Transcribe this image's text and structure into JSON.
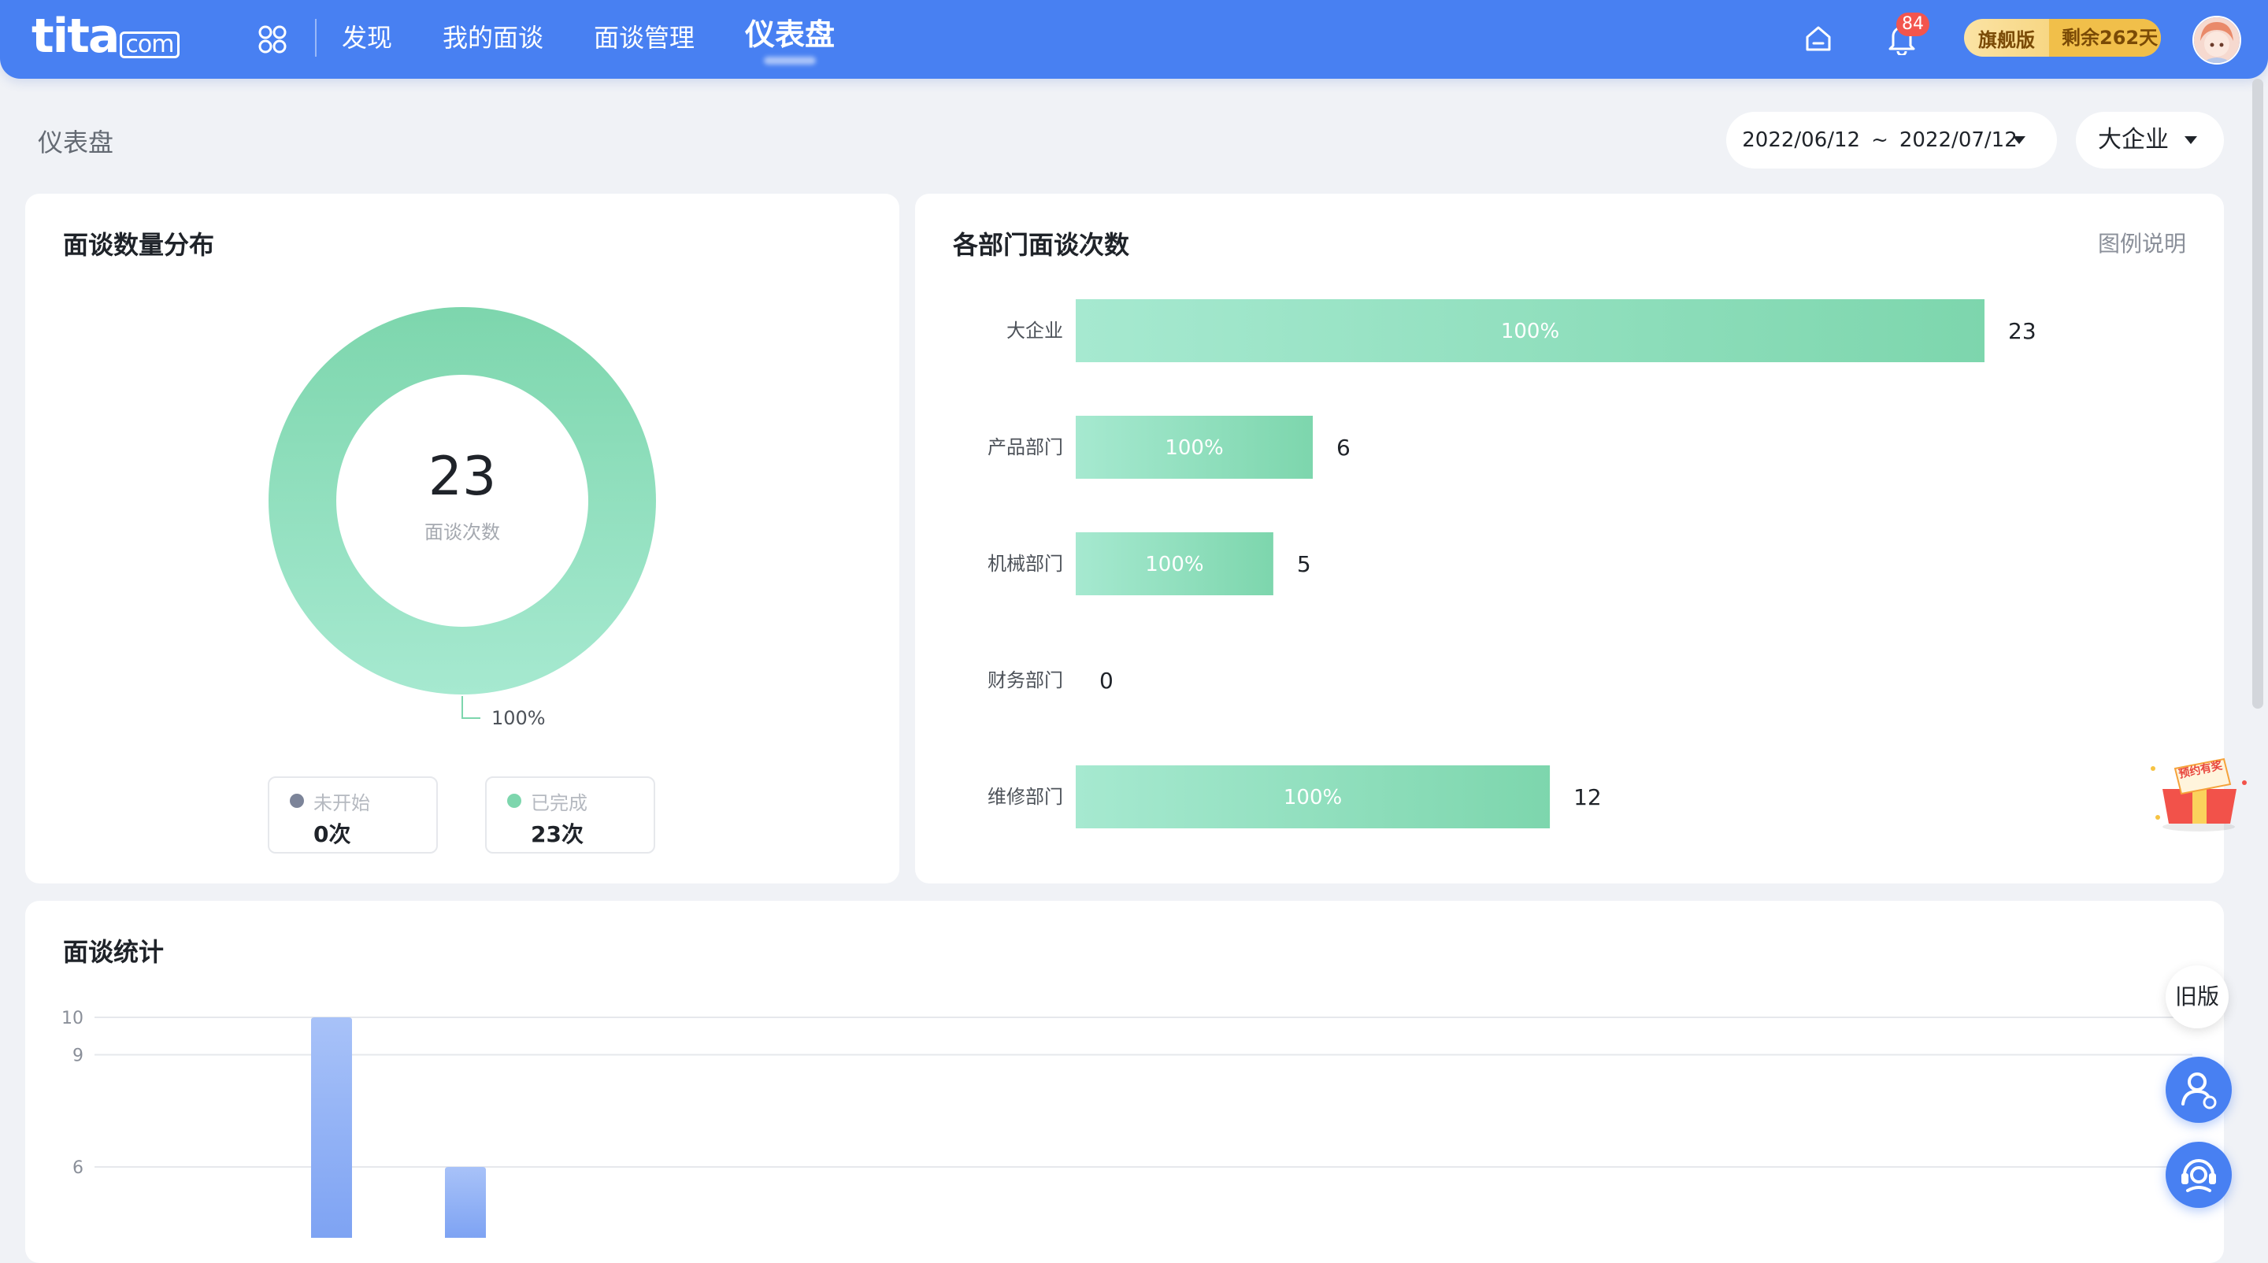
{
  "nav": {
    "logo_main": "tita",
    "logo_suffix": "com",
    "items": [
      "发现",
      "我的面谈",
      "面谈管理",
      "仪表盘"
    ],
    "active_index": 3,
    "notifications_count": "84",
    "plan_name": "旗舰版",
    "plan_remaining": "剩余262天"
  },
  "page": {
    "title": "仪表盘",
    "date_start": "2022/06/12",
    "date_separator": "~",
    "date_end": "2022/07/12",
    "dept_selected": "大企业"
  },
  "donut_card": {
    "title": "面谈数量分布",
    "center_value": "23",
    "center_label": "面谈次数",
    "slice_label": "100%",
    "legend": [
      {
        "label": "未开始",
        "value": "0次",
        "color": "#7c8499"
      },
      {
        "label": "已完成",
        "value": "23次",
        "color": "#7dd6ad"
      }
    ]
  },
  "bar_card": {
    "title": "各部门面谈次数",
    "legend_link": "图例说明"
  },
  "stats_card": {
    "title": "面谈统计"
  },
  "floating": {
    "old_version": "旧版",
    "gift_text": "预约有奖"
  },
  "colors": {
    "brand": "#4880f2",
    "green_start": "#a6e9d0",
    "green_end": "#7dd6ad",
    "blue_bar": "#8fb0f6"
  },
  "chart_data": [
    {
      "type": "pie",
      "title": "面谈数量分布",
      "categories": [
        "未开始",
        "已完成"
      ],
      "values": [
        0,
        23
      ],
      "total": 23
    },
    {
      "type": "bar",
      "orientation": "horizontal",
      "title": "各部门面谈次数",
      "categories": [
        "大企业",
        "产品部门",
        "机械部门",
        "财务部门",
        "维修部门"
      ],
      "values": [
        23,
        6,
        5,
        0,
        12
      ],
      "bar_labels": [
        "100%",
        "100%",
        "100%",
        "",
        "100%"
      ],
      "xlim": [
        0,
        23
      ]
    },
    {
      "type": "bar",
      "title": "面谈统计",
      "yticks": [
        6,
        9,
        10
      ],
      "values_visible": [
        10,
        6
      ],
      "ylim_top": 10
    }
  ]
}
